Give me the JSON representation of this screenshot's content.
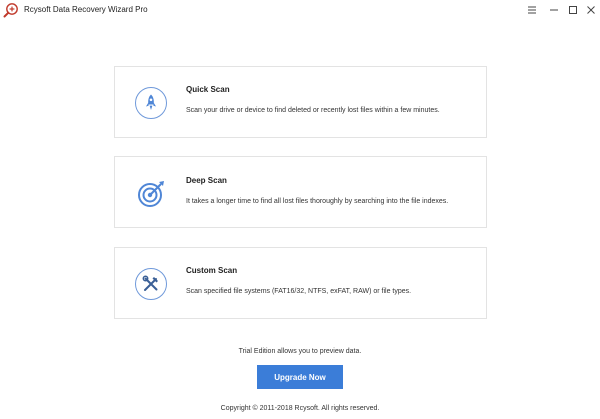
{
  "window": {
    "title": "Rcysoft Data Recovery Wizard Pro",
    "app_icon": "magnifier-plus-icon",
    "controls": [
      "menu-icon",
      "minimize-icon",
      "maximize-icon",
      "close-icon"
    ]
  },
  "scans": [
    {
      "title": "Quick Scan",
      "description": "Scan your drive or device to find deleted or recently lost files within a few minutes.",
      "icon": "rocket-icon"
    },
    {
      "title": "Deep Scan",
      "description": "It takes a longer time to find all lost files thoroughly by searching into the file indexes.",
      "icon": "target-icon"
    },
    {
      "title": "Custom Scan",
      "description": "Scan specified file systems (FAT16/32, NTFS, exFAT, RAW) or file types.",
      "icon": "tools-icon"
    }
  ],
  "footer": {
    "trial_note": "Trial Edition allows you to preview data.",
    "upgrade_label": "Upgrade Now",
    "copyright": "Copyright © 2011-2018 Rcysoft. All rights reserved."
  },
  "colors": {
    "accent": "#3b7dd8",
    "icon": "#4f86d6",
    "card_border": "#e3e3e3"
  }
}
